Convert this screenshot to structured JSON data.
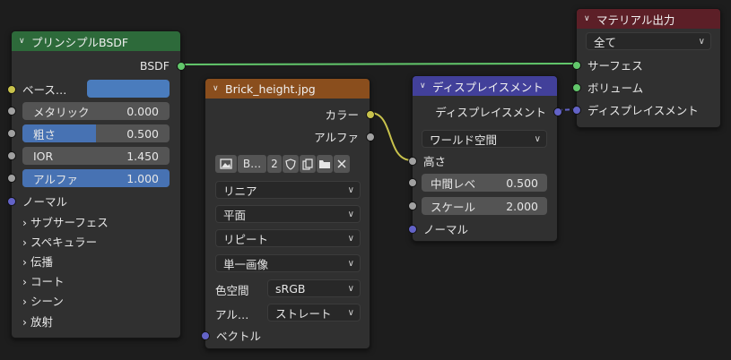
{
  "colors": {
    "background": "#1d1d1d",
    "node_body": "#303030",
    "header_shader": "#2d6a3a",
    "header_texture": "#8a4e1d",
    "header_vector": "#42409a",
    "header_output": "#5c1f27",
    "socket_shader": "#62c76b",
    "socket_color": "#c8c24c",
    "socket_float": "#a1a1a1",
    "socket_vector": "#6363c7",
    "slider_fill": "#4772b3",
    "base_color_swatch": "#4a7cbd"
  },
  "principled": {
    "title": "プリンシプルBSDF",
    "output_bsdf": "BSDF",
    "base_color_label": "ベース…",
    "fields": [
      {
        "label": "メタリック",
        "value": "0.000",
        "fill": 0.0
      },
      {
        "label": "粗さ",
        "value": "0.500",
        "fill": 0.5
      },
      {
        "label": "IOR",
        "value": "1.450",
        "fill": 0.0
      },
      {
        "label": "アルファ",
        "value": "1.000",
        "fill": 1.0
      }
    ],
    "normal_label": "ノーマル",
    "panels": [
      "サブサーフェス",
      "スペキュラー",
      "伝播",
      "コート",
      "シーン",
      "放射"
    ]
  },
  "image": {
    "title": "Brick_height.jpg",
    "out_color": "カラー",
    "out_alpha": "アルファ",
    "image_name": "B…",
    "users": "2",
    "interpolation": "リニア",
    "projection": "平面",
    "extension": "リピート",
    "source": "単一画像",
    "colorspace_label": "色空間",
    "colorspace_value": "sRGB",
    "alpha_label": "アル…",
    "alpha_value": "ストレート",
    "vector_label": "ベクトル"
  },
  "displacement": {
    "title": "ディスプレイスメント",
    "output": "ディスプレイスメント",
    "space": "ワールド空間",
    "height_label": "高さ",
    "midlevel_label": "中間レベ",
    "midlevel_value": "0.500",
    "scale_label": "スケール",
    "scale_value": "2.000",
    "normal_label": "ノーマル"
  },
  "output": {
    "title": "マテリアル出力",
    "target": "全て",
    "surface": "サーフェス",
    "volume": "ボリューム",
    "displacement": "ディスプレイスメント"
  }
}
